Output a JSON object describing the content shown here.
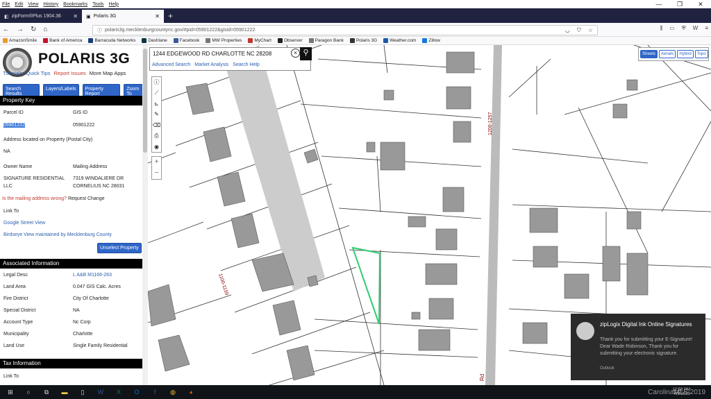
{
  "browser": {
    "menu": [
      "File",
      "Edit",
      "View",
      "History",
      "Bookmarks",
      "Tools",
      "Help"
    ],
    "tabs": [
      {
        "label": "zipForm®Plus 1904.36",
        "active": false
      },
      {
        "label": "Polaris 3G",
        "active": true
      }
    ],
    "url": "polaris3g.mecklenburgcountync.gov/#pid=05901222&gisid=05901222",
    "bookmarks": [
      "AmazonSmile",
      "Bank of America",
      "Barracuda Networks",
      "Dashlane",
      "Facebook",
      "MW Properties",
      "MyChart",
      "Observer",
      "Paragon Bank",
      "Polaris 3G",
      "Weather.com",
      "Zillow"
    ]
  },
  "app": {
    "title": "POLARIS 3G",
    "links": {
      "tutorials": "Tutorials",
      "quick_tips": "Quick Tips",
      "report_issues": "Report Issues",
      "more_apps": "More Map Apps"
    },
    "buttons": {
      "search_results": "Search Results",
      "layers": "Layers/Labels",
      "property_report": "Property Report",
      "zoom": "Zoom To"
    }
  },
  "property_key": {
    "header": "Property Key",
    "parcel_label": "Parcel ID",
    "parcel_value": "05901222",
    "gis_label": "GIS ID",
    "gis_value": "05901222",
    "address_label": "Address located on Property (Postal City)",
    "address_value": "NA",
    "owner_label": "Owner Name",
    "owner_value_1": "SIGNATURE RESIDENTIAL",
    "owner_value_2": "LLC",
    "mailing_label": "Mailing Address",
    "mailing_value_1": "7319 WINDALIERE DR",
    "mailing_value_2": "CORNELIUS NC 28031",
    "mailing_question": "Is the mailing address wrong?",
    "request_change": "Request Change",
    "link_to": "Link To",
    "street_view": "Google Street View",
    "birdseye": "Birdseye View maintained by Mecklenburg County",
    "unselect": "Unselect Property"
  },
  "associated": {
    "header": "Associated Information",
    "rows": [
      {
        "k": "Legal Desc",
        "v": "L A&B M1166-263",
        "link": true
      },
      {
        "k": "Land Area",
        "v": "0.047 GIS Calc. Acres"
      },
      {
        "k": "Fire District",
        "v": "City Of Charlotte"
      },
      {
        "k": "Special District",
        "v": "NA"
      },
      {
        "k": "Account Type",
        "v": "Nc Corp"
      },
      {
        "k": "Municipality",
        "v": "Charlotte"
      },
      {
        "k": "Land Use",
        "v": "Single Family Residential"
      }
    ]
  },
  "tax": {
    "header": "Tax Information",
    "link_to": "Link To"
  },
  "map": {
    "search_value": "1244 EDGEWOOD RD CHARLOTTE NC 28208",
    "search_links": [
      "Advanced Search",
      "Market Analysis",
      "Search Help"
    ],
    "layers": [
      {
        "label": "Streets",
        "on": true
      },
      {
        "label": "Aerials",
        "on": false
      },
      {
        "label": "Hybrid",
        "on": false
      },
      {
        "label": "Topo",
        "on": false
      }
    ],
    "road_labels": [
      "1200-1257",
      "1100-1159",
      "Rd"
    ],
    "highlight_color": "#2ecc71"
  },
  "toast": {
    "title": "zipLogix Digital Ink Online Signatures",
    "body": "Thank you for submitting your E-Signature!\nDear Wade Robinson,  Thank you for submitting your electronic signature.",
    "source": "Outlook"
  },
  "taskbar": {
    "time": "12:58 PM",
    "date": "4/9/2019",
    "watermark": "CarolinaMLS 2019"
  }
}
